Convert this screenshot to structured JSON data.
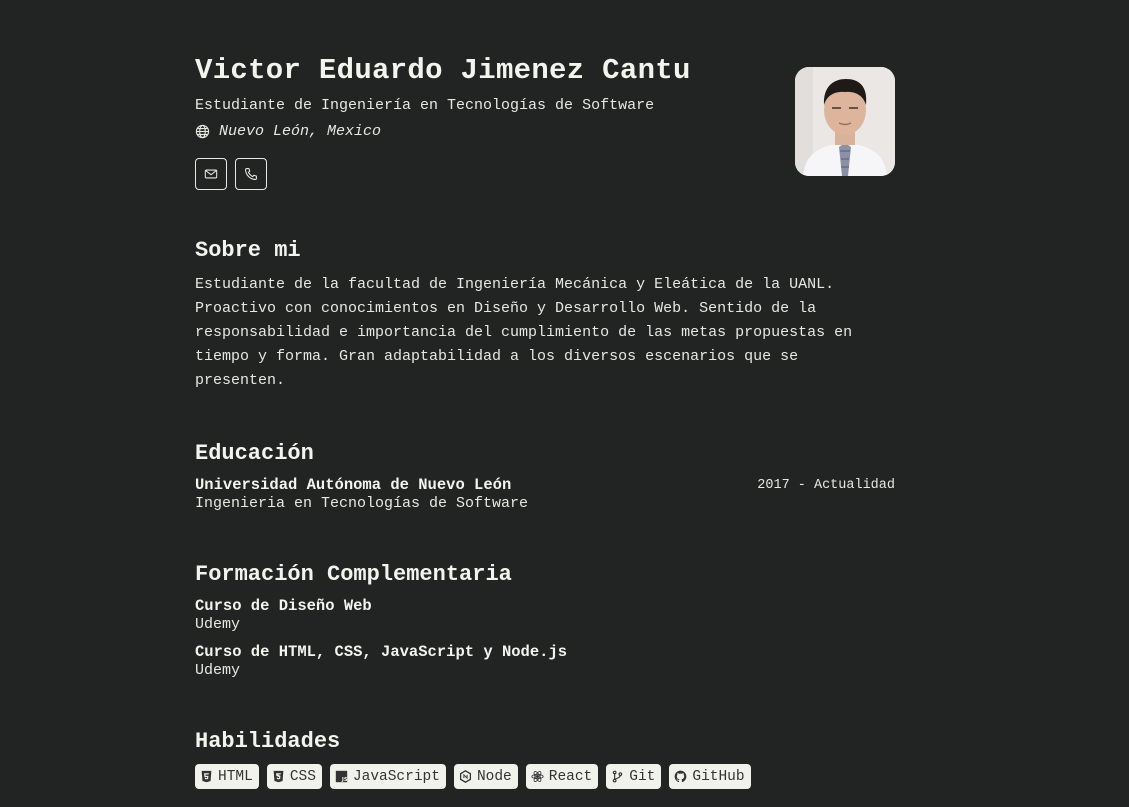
{
  "profile": {
    "name": "Victor Eduardo Jimenez Cantu",
    "subtitle": "Estudiante de Ingeniería en Tecnologías de Software",
    "location": "Nuevo León, Mexico",
    "location_icon": "globe-icon",
    "contacts": [
      {
        "icon": "mail-icon"
      },
      {
        "icon": "phone-icon"
      }
    ]
  },
  "about": {
    "heading": "Sobre mi",
    "text": "Estudiante de la facultad de Ingeniería Mecánica y Eleática de la UANL. Proactivo con conocimientos en Diseño y Desarrollo Web. Sentido de la responsabilidad e importancia del cumplimiento de las metas propuestas en tiempo y forma. Gran adaptabilidad a los diversos escenarios que se presenten."
  },
  "education": {
    "heading": "Educación",
    "items": [
      {
        "school": "Universidad Autónoma de Nuevo León",
        "years": "2017 - Actualidad",
        "degree": "Ingenieria en Tecnologías de Software"
      }
    ]
  },
  "training": {
    "heading": "Formación Complementaria",
    "items": [
      {
        "title": "Curso de Diseño Web",
        "org": "Udemy"
      },
      {
        "title": "Curso de HTML, CSS, JavaScript y Node.js",
        "org": "Udemy"
      }
    ]
  },
  "skills": {
    "heading": "Habilidades",
    "items": [
      {
        "label": "HTML",
        "icon": "html5-icon"
      },
      {
        "label": "CSS",
        "icon": "css3-icon"
      },
      {
        "label": "JavaScript",
        "icon": "javascript-icon"
      },
      {
        "label": "Node",
        "icon": "nodejs-icon"
      },
      {
        "label": "React",
        "icon": "react-icon"
      },
      {
        "label": "Git",
        "icon": "git-icon"
      },
      {
        "label": "GitHub",
        "icon": "github-icon"
      }
    ]
  },
  "colors": {
    "background": "#222323",
    "text": "#f0f0e8",
    "badge_bg": "#f2f2ec"
  }
}
